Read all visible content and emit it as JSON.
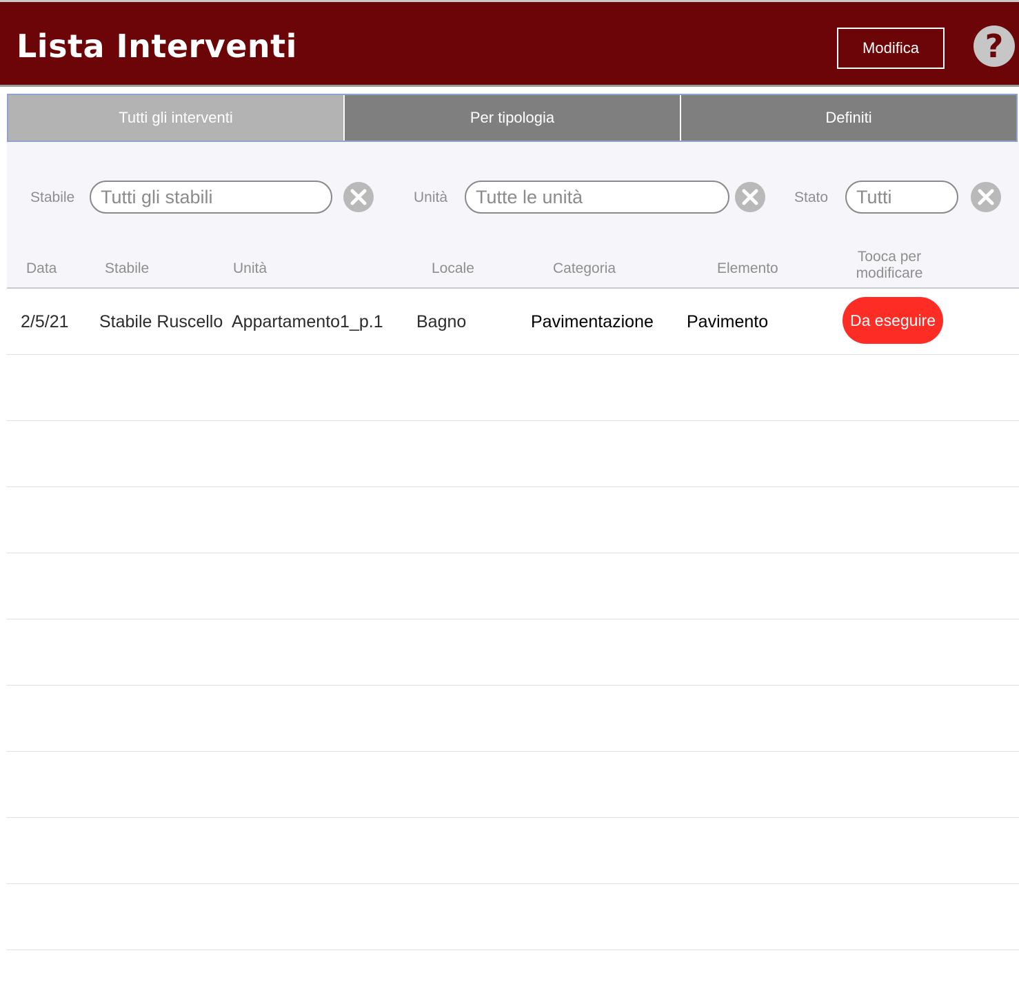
{
  "header": {
    "title": "Lista Interventi",
    "edit_label": "Modifica",
    "help_glyph": "?"
  },
  "tabs": [
    {
      "label": "Tutti gli interventi",
      "active": true
    },
    {
      "label": "Per tipologia",
      "active": false
    },
    {
      "label": "Definiti",
      "active": false
    }
  ],
  "filters": {
    "building": {
      "label": "Stabile",
      "value": "Tutti gli stabili"
    },
    "unit": {
      "label": "Unità",
      "value": "Tutte le unità"
    },
    "status": {
      "label": "Stato",
      "value": "Tutti"
    }
  },
  "columns": {
    "date": "Data",
    "building": "Stabile",
    "unit": "Unità",
    "room": "Locale",
    "category": "Categoria",
    "element": "Elemento",
    "action_line1": "Tooca per",
    "action_line2": "modificare"
  },
  "rows": [
    {
      "date": "2/5/21",
      "building": "Stabile Ruscello",
      "unit": "Appartamento1_p.1",
      "room": "Bagno",
      "category": "Pavimentazione",
      "element": "Pavimento",
      "status": "Da eseguire"
    }
  ],
  "colors": {
    "header_bg": "#6b0507",
    "tab_active": "#b3b3b3",
    "tab_inactive": "#7f7f7f",
    "status_pending": "#fd2c25"
  },
  "icons": {
    "help": "help-icon",
    "clear": "clear-circle-x-icon"
  }
}
